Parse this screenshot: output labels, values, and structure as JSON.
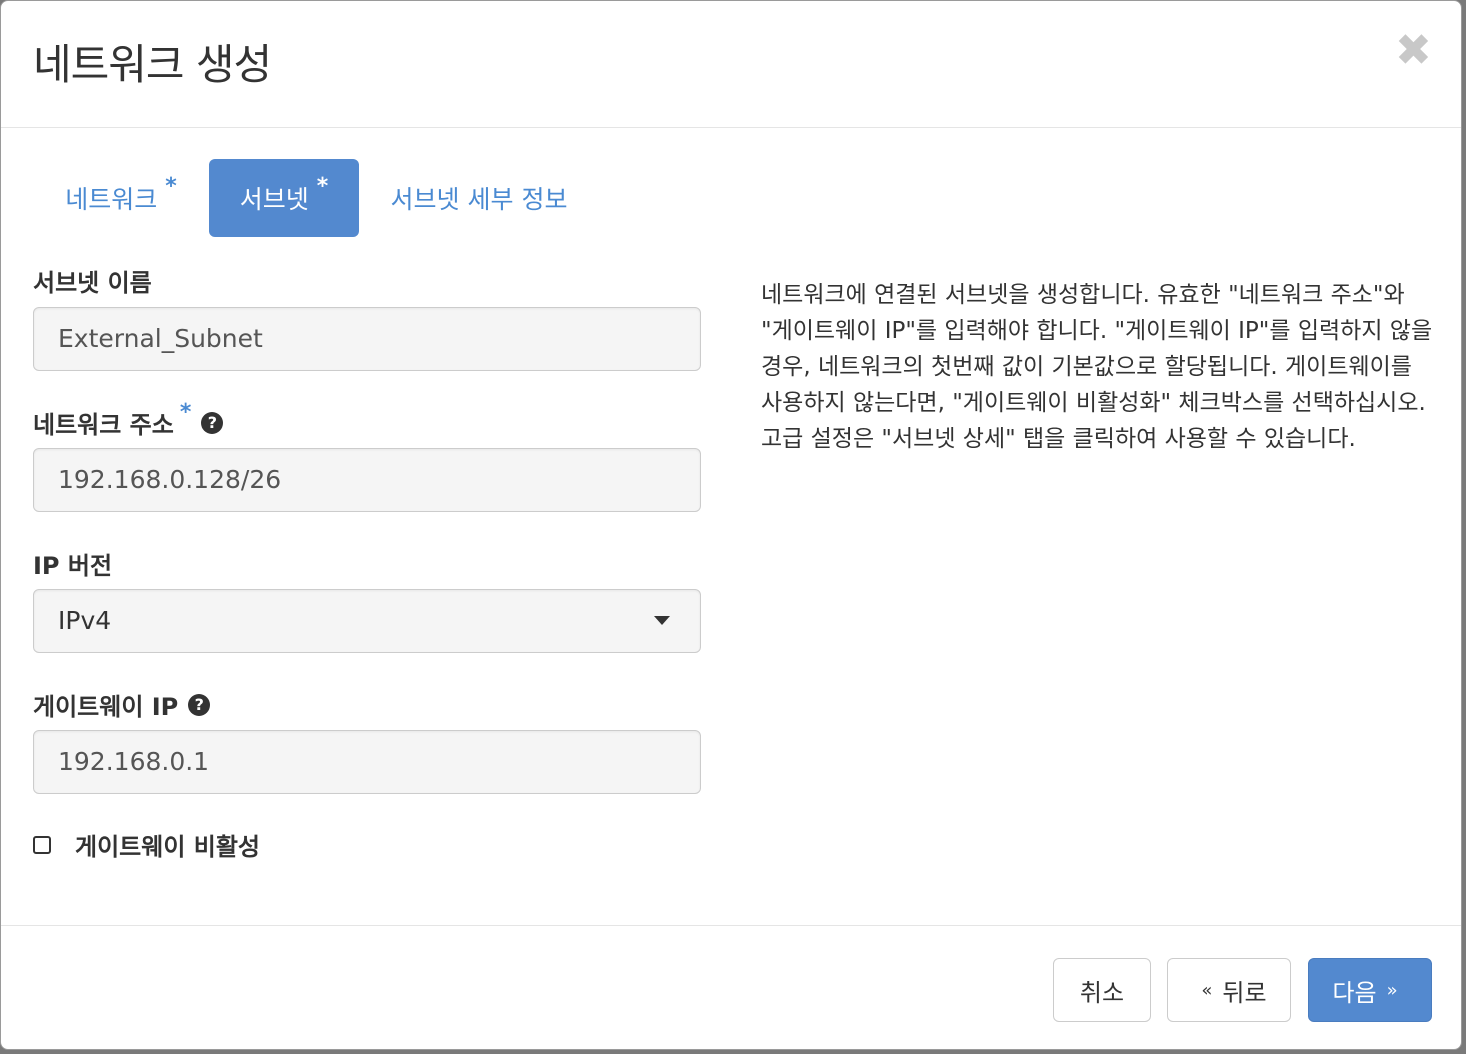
{
  "dialog": {
    "title": "네트워크 생성"
  },
  "tabs": [
    {
      "label": "네트워크",
      "required": "*"
    },
    {
      "label": "서브넷",
      "required": "*"
    },
    {
      "label": "서브넷 세부 정보"
    }
  ],
  "form": {
    "subnet_name": {
      "label": "서브넷 이름",
      "value": "External_Subnet"
    },
    "network_address": {
      "label": "네트워크 주소",
      "required": "*",
      "value": "192.168.0.128/26"
    },
    "ip_version": {
      "label": "IP 버전",
      "selected": "IPv4"
    },
    "gateway_ip": {
      "label": "게이트웨이 IP",
      "value": "192.168.0.1"
    },
    "disable_gateway": {
      "label": "게이트웨이 비활성",
      "checked": false
    }
  },
  "help_text": "네트워크에 연결된 서브넷을 생성합니다. 유효한 \"네트워크 주소\"와 \"게이트웨이 IP\"를 입력해야 합니다. \"게이트웨이 IP\"를 입력하지 않을 경우, 네트워크의 첫번째 값이 기본값으로 할당됩니다. 게이트웨이를 사용하지 않는다면, \"게이트웨이 비활성화\" 체크박스를 선택하십시오. 고급 설정은 \"서브넷 상세\" 탭을 클릭하여 사용할 수 있습니다.",
  "footer": {
    "cancel_label": "취소",
    "back_label": "뒤로",
    "back_chevron": "«",
    "next_label": "다음",
    "next_chevron": "»"
  },
  "icons": {
    "close": "close-icon",
    "help": "question-circle-icon",
    "dropdown": "caret-down-icon"
  },
  "colors": {
    "primary": "#5389cf",
    "link": "#4a8ad2"
  }
}
